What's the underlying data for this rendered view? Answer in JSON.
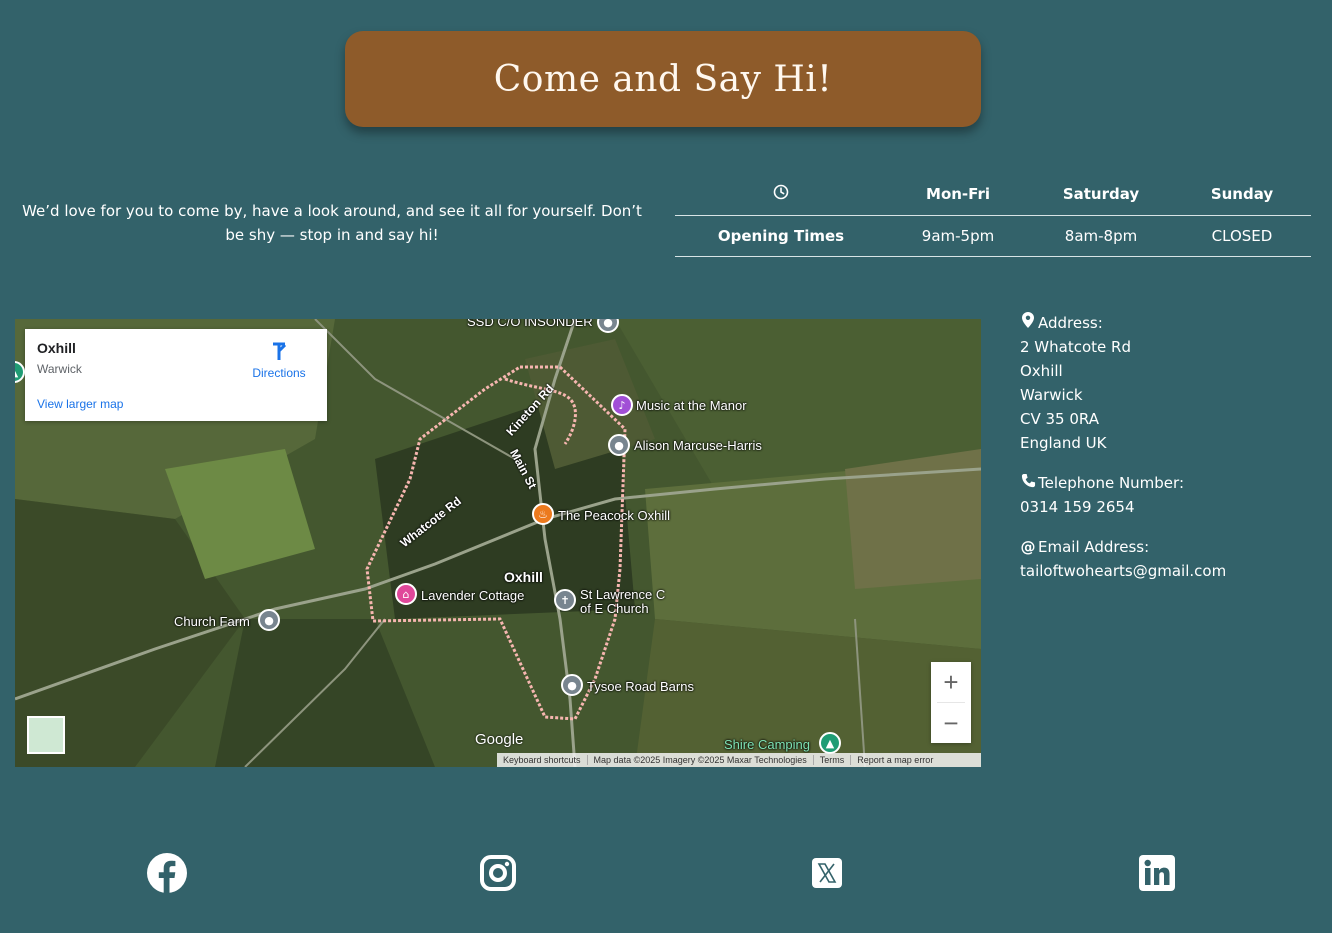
{
  "title": "Come and Say Hi!",
  "intro": "We’d love for you to come by, have a look around, and see it all for yourself. Don’t be shy — stop in and say hi!",
  "hours": {
    "headers": [
      "Mon-Fri",
      "Saturday",
      "Sunday"
    ],
    "row_label": "Opening Times",
    "values": [
      "9am-5pm",
      "8am-8pm",
      "CLOSED"
    ],
    "header_icon": "clock-icon"
  },
  "map": {
    "card": {
      "name": "Oxhill",
      "region": "Warwick",
      "directions": "Directions",
      "larger_map": "View larger map"
    },
    "places": [
      "SSD C/O INSONDER",
      "Music at the Manor",
      "Alison Marcuse-Harris",
      "The Peacock Oxhill",
      "Oxhill",
      "Lavender Cottage",
      "St Lawrence C",
      "of E Church",
      "Church Farm",
      "Tysoe Road Barns",
      "Shire Camping"
    ],
    "roads": [
      "Kineton Rd",
      "Main St",
      "Whatcote Rd"
    ],
    "zoom_in": "+",
    "zoom_out": "−",
    "logo": "Google",
    "attribution": [
      "Keyboard shortcuts",
      "Map data ©2025 Imagery ©2025 Maxar Technologies",
      "Terms",
      "Report a map error"
    ]
  },
  "contact": {
    "address_label": "Address:",
    "address_lines": [
      "2 Whatcote Rd",
      "Oxhill",
      "Warwick",
      "CV 35 0RA",
      "England UK"
    ],
    "phone_label": "Telephone Number:",
    "phone": "0314 159 2654",
    "email_label": "Email Address:",
    "email": "tailoftwohearts@gmail.com"
  },
  "social": [
    "facebook-icon",
    "instagram-icon",
    "x-twitter-icon",
    "linkedin-icon"
  ],
  "colors": {
    "background": "#33626a",
    "title_box": "#8e5b2a",
    "text": "#ffffff"
  }
}
